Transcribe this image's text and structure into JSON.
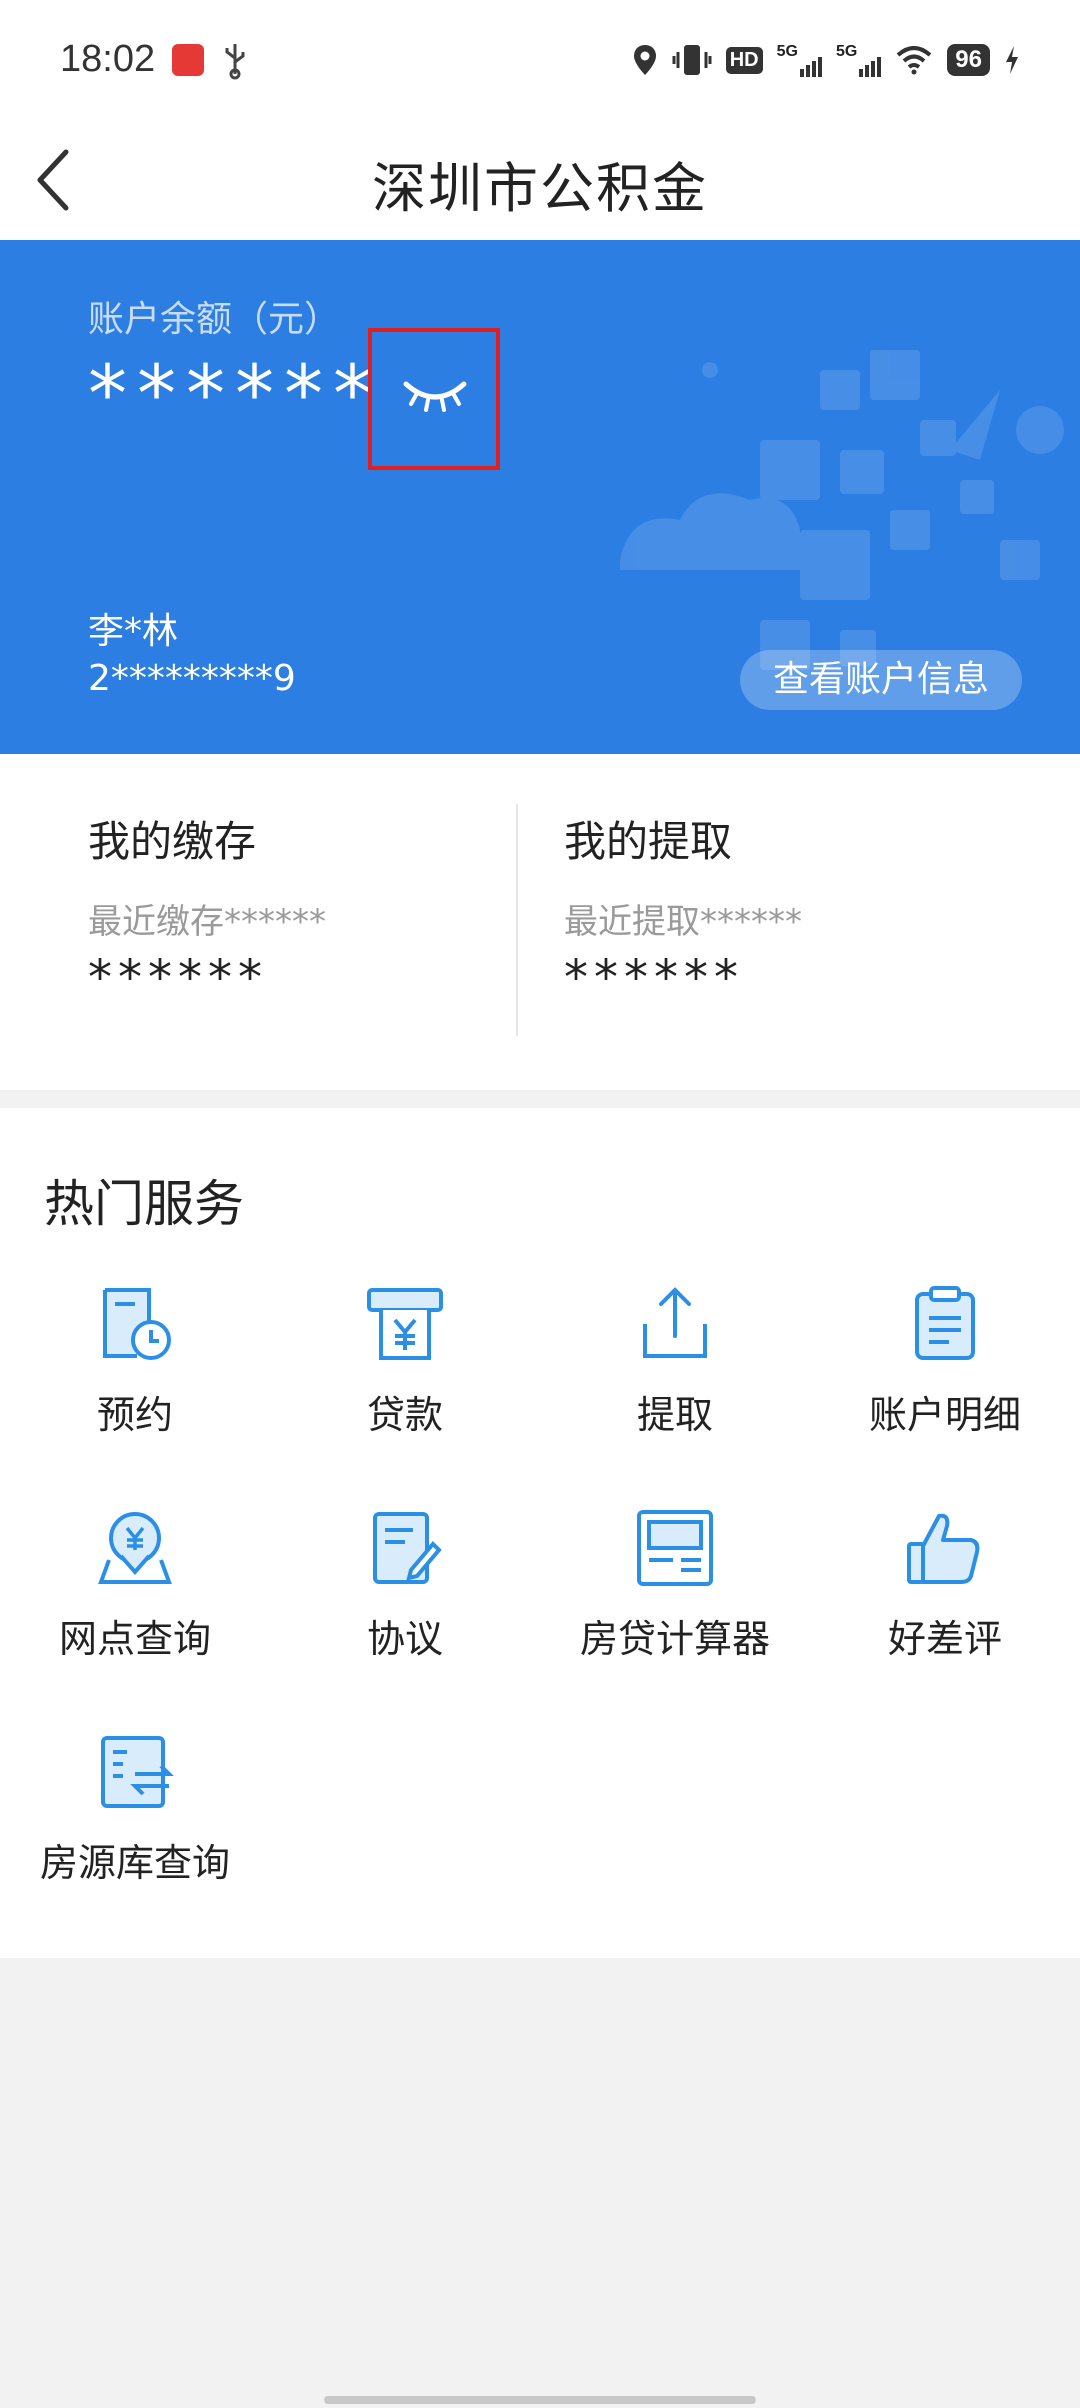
{
  "status_bar": {
    "time": "18:02",
    "network_1": "5G",
    "network_2": "5G",
    "hd_label": "HD",
    "battery": "96",
    "icons": [
      "location-icon",
      "vibrate-icon",
      "hd-icon",
      "signal-icon",
      "wifi-icon",
      "battery-icon",
      "charging-icon"
    ]
  },
  "header": {
    "title": "深圳市公积金"
  },
  "balance_card": {
    "label": "账户余额（元）",
    "value": "******",
    "name": "李*林",
    "account_number": "2*********9",
    "view_button": "查看账户信息",
    "colors": {
      "background": "#2c7ee3",
      "highlight": "#e02020"
    }
  },
  "summary": {
    "deposit": {
      "title": "我的缴存",
      "sub": "最近缴存******",
      "value": "******"
    },
    "withdraw": {
      "title": "我的提取",
      "sub": "最近提取******",
      "value": "******"
    }
  },
  "services": {
    "title": "热门服务",
    "items": [
      {
        "label": "预约",
        "icon": "appointment-icon"
      },
      {
        "label": "贷款",
        "icon": "loan-icon"
      },
      {
        "label": "提取",
        "icon": "withdraw-icon"
      },
      {
        "label": "账户明细",
        "icon": "account-detail-icon"
      },
      {
        "label": "网点查询",
        "icon": "branch-search-icon"
      },
      {
        "label": "协议",
        "icon": "agreement-icon"
      },
      {
        "label": "房贷计算器",
        "icon": "mortgage-calculator-icon"
      },
      {
        "label": "好差评",
        "icon": "rating-icon"
      },
      {
        "label": "房源库查询",
        "icon": "housing-search-icon"
      }
    ],
    "icon_color": "#2c8fe6"
  }
}
